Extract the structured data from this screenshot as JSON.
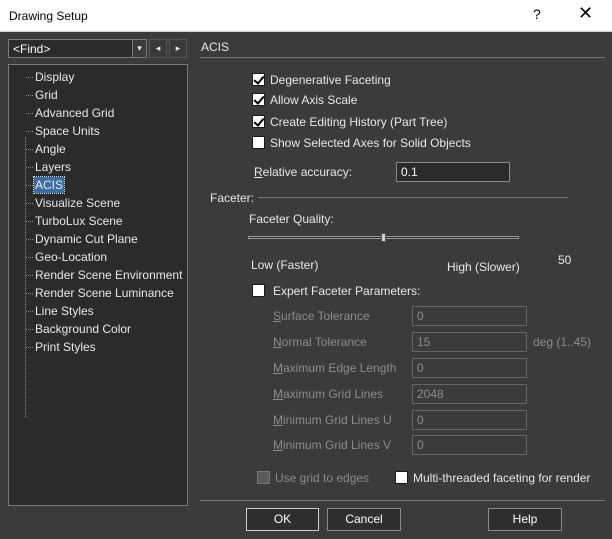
{
  "window": {
    "title": "Drawing Setup",
    "help_glyph": "?",
    "close_glyph": "✕"
  },
  "find": {
    "value": "<Find>",
    "dropdown_glyph": "▾",
    "prev_glyph": "◂",
    "next_glyph": "▸"
  },
  "tree": {
    "items": [
      "Display",
      "Grid",
      "Advanced Grid",
      "Space Units",
      "Angle",
      "Layers",
      "ACIS",
      "Visualize Scene",
      "TurboLux Scene",
      "Dynamic Cut Plane",
      "Geo-Location",
      "Render Scene Environment",
      "Render Scene Luminance",
      "Line Styles",
      "Background Color",
      "Print Styles"
    ],
    "selected": "ACIS"
  },
  "section": {
    "title": "ACIS"
  },
  "options": {
    "degenerative_faceting": {
      "label": "Degenerative Faceting",
      "checked": true
    },
    "allow_axis_scale": {
      "label": "Allow Axis Scale",
      "checked": true
    },
    "create_editing_history": {
      "label": "Create Editing History (Part Tree)",
      "checked": true
    },
    "show_selected_axes": {
      "label": "Show Selected Axes for Solid Objects",
      "checked": false
    }
  },
  "relative_accuracy": {
    "label_first": "R",
    "label_rest": "elative accuracy:",
    "value": "0.1"
  },
  "faceter": {
    "group_label": "Faceter:",
    "quality_label": "Faceter Quality:",
    "low_label": "Low (Faster)",
    "high_label": "High (Slower)",
    "quality_value": "50",
    "quality_fraction": 0.5,
    "expert_label": "Expert Faceter Parameters:",
    "expert_checked": false
  },
  "params": [
    {
      "label_first": "S",
      "label_rest": "urface Tolerance",
      "value": "0",
      "unit": ""
    },
    {
      "label_first": "N",
      "label_rest": "ormal Tolerance",
      "value": "15",
      "unit": "deg (1..45)"
    },
    {
      "label_first": "M",
      "label_rest": "aximum Edge Length",
      "value": "0",
      "unit": ""
    },
    {
      "label_first": "M",
      "label_rest": "aximum Grid Lines",
      "value": "2048",
      "unit": ""
    },
    {
      "label_first": "M",
      "label_rest": "inimum Grid Lines U",
      "value": "0",
      "unit": ""
    },
    {
      "label_first": "M",
      "label_rest": "inimum Grid Lines V",
      "value": "0",
      "unit": ""
    }
  ],
  "use_grid_to_edges": {
    "label": "Use grid to edges",
    "checked": false,
    "enabled": false
  },
  "multithreaded": {
    "label": "Multi-threaded faceting for render",
    "checked": false
  },
  "buttons": {
    "ok": "OK",
    "cancel": "Cancel",
    "help": "Help"
  }
}
